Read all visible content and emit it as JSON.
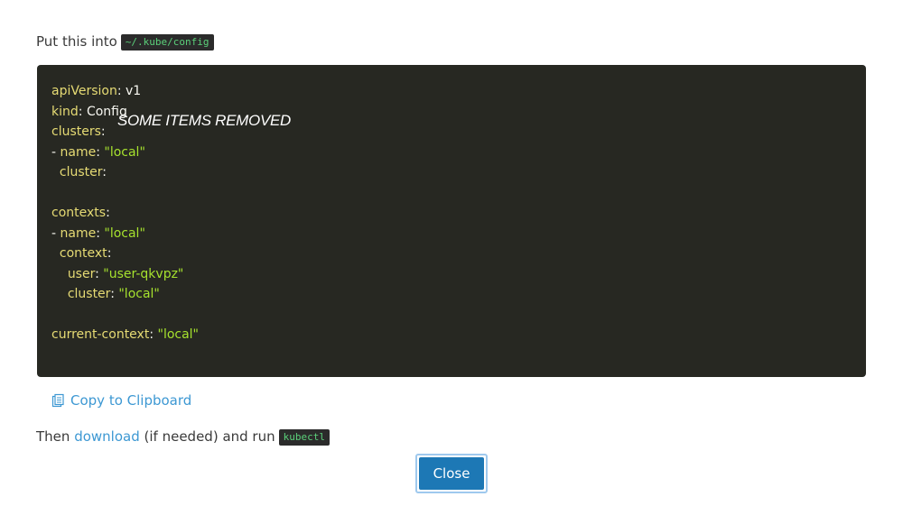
{
  "intro": {
    "text": "Put this into",
    "path": "~/.kube/config"
  },
  "code": {
    "lines": [
      {
        "key": "apiVersion",
        "sep": ": ",
        "value": "v1",
        "vtype": "d",
        "indent": ""
      },
      {
        "key": "kind",
        "sep": ": ",
        "value": "Config",
        "vtype": "d",
        "indent": ""
      },
      {
        "key": "clusters",
        "sep": ":",
        "value": "",
        "vtype": "d",
        "indent": ""
      },
      {
        "key": "name",
        "sep": ": ",
        "value": "\"local\"",
        "vtype": "s",
        "indent": "- "
      },
      {
        "key": "cluster",
        "sep": ":",
        "value": "",
        "vtype": "d",
        "indent": "  "
      },
      {
        "key": "",
        "sep": "",
        "value": "",
        "vtype": "d",
        "indent": ""
      },
      {
        "key": "contexts",
        "sep": ":",
        "value": "",
        "vtype": "d",
        "indent": ""
      },
      {
        "key": "name",
        "sep": ": ",
        "value": "\"local\"",
        "vtype": "s",
        "indent": "- "
      },
      {
        "key": "context",
        "sep": ":",
        "value": "",
        "vtype": "d",
        "indent": "  "
      },
      {
        "key": "user",
        "sep": ": ",
        "value": "\"user-qkvpz\"",
        "vtype": "s",
        "indent": "    "
      },
      {
        "key": "cluster",
        "sep": ": ",
        "value": "\"local\"",
        "vtype": "s",
        "indent": "    "
      },
      {
        "key": "",
        "sep": "",
        "value": "",
        "vtype": "d",
        "indent": ""
      },
      {
        "key": "current-context",
        "sep": ": ",
        "value": "\"local\"",
        "vtype": "s",
        "indent": ""
      }
    ],
    "overlay_note": "SOME ITEMS REMOVED"
  },
  "copy": {
    "label": "Copy to Clipboard",
    "icon": "clipboard-icon"
  },
  "then": {
    "prefix": "Then",
    "link": "download",
    "middle": "(if needed) and run",
    "command": "kubectl"
  },
  "close_button": {
    "label": "Close"
  },
  "colors": {
    "code_bg": "#272822",
    "code_key": "#e6db74",
    "code_string": "#a6e22e",
    "link": "#3d98d3",
    "button_bg": "#1d78b5"
  }
}
